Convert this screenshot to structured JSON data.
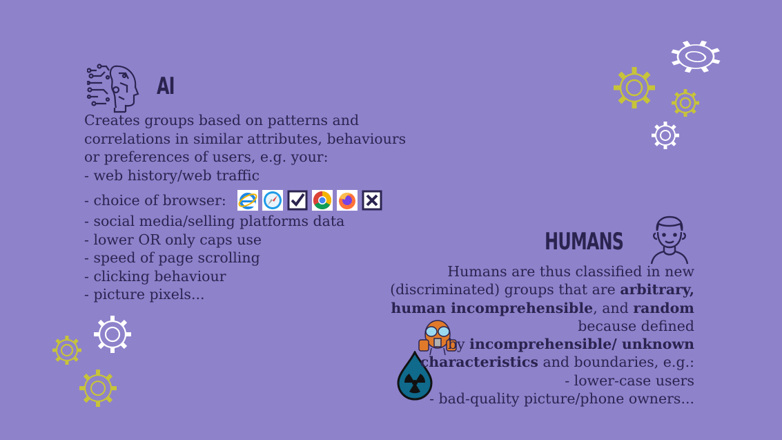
{
  "ai": {
    "title": "AI",
    "intro_lines": [
      "Creates groups based on patterns and",
      "correlations in similar attributes, behaviours",
      "or preferences of users, e.g. your:",
      "- web history/web traffic"
    ],
    "browser_line": "- choice of browser:",
    "browser_icons": [
      "internet-explorer-icon",
      "safari-icon",
      "checkbox-checked-icon",
      "chrome-icon",
      "firefox-icon",
      "checkbox-crossed-icon"
    ],
    "more_lines": [
      "- social media/selling platforms data",
      "- lower OR only caps use",
      "- speed of page scrolling",
      "- clicking behaviour",
      "- picture pixels..."
    ]
  },
  "humans": {
    "title": "HUMANS",
    "line1": "Humans are thus classified in new",
    "line2_a": "(discriminated) groups that are ",
    "line2_b": "arbitrary,",
    "line3_a": "human incomprehensible",
    "line3_b": ", and ",
    "line3_c": "random",
    "line4": "because defined",
    "line5_a": "by ",
    "line5_b": "incomprehensible/ unknown",
    "line6_a": "characteristics",
    "line6_b": " and boundaries, e.g.:",
    "line7": "- lower-case users",
    "line8": "- bad-quality picture/phone owners..."
  },
  "colors": {
    "background": "#8e82cb",
    "text": "#2b2450",
    "gear_yellow": "#c7c33a",
    "gear_white": "#ffffff"
  }
}
